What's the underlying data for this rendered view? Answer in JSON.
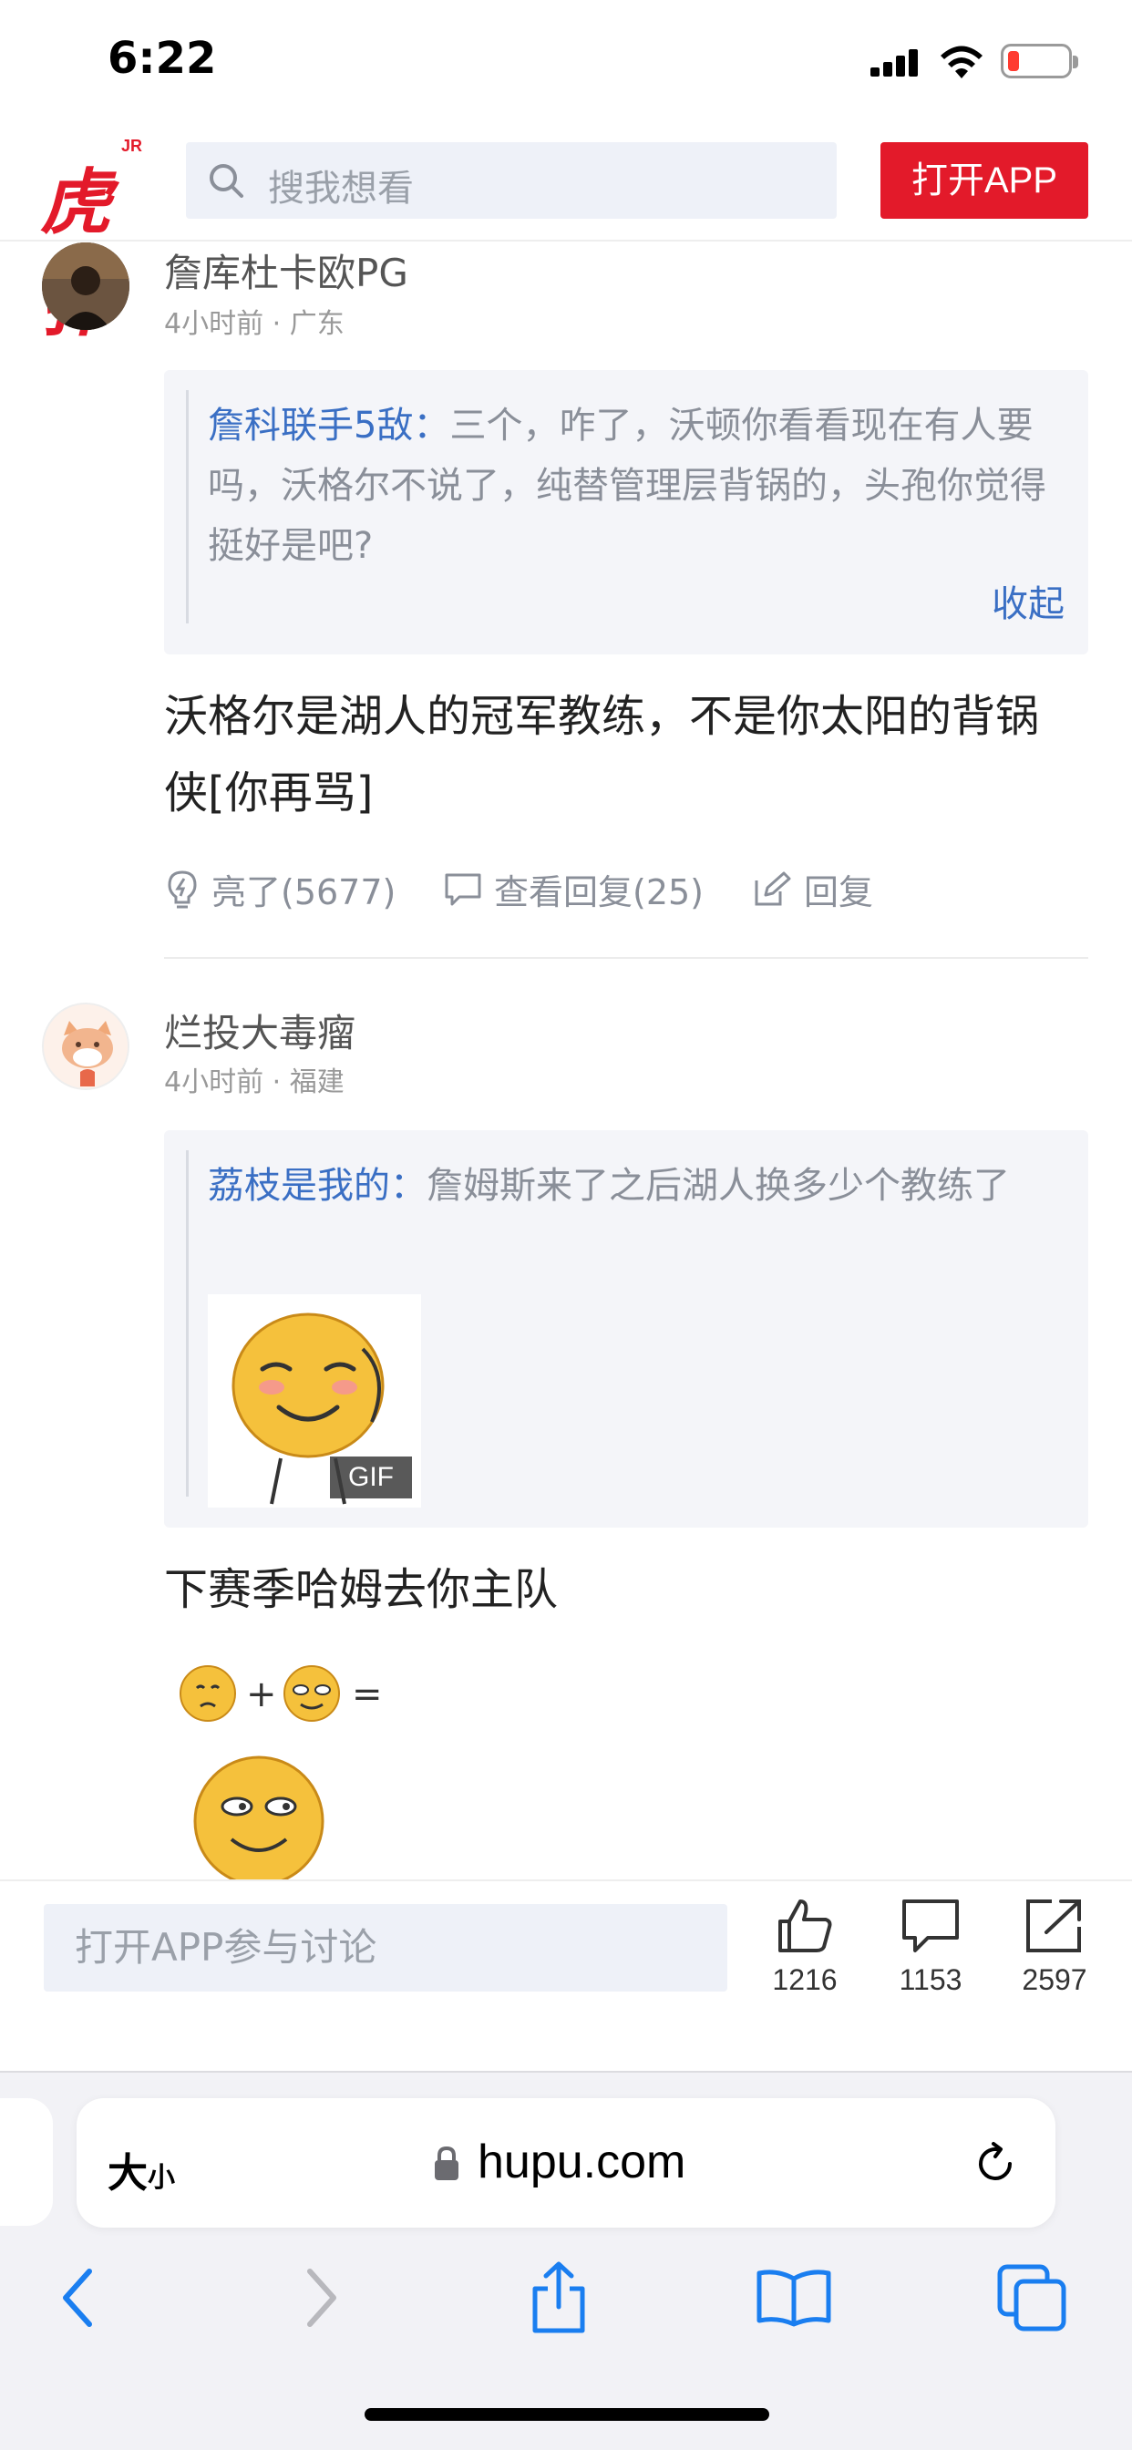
{
  "status_bar": {
    "time": "6:22"
  },
  "header": {
    "logo_text": "虎扑",
    "logo_badge": "JR",
    "search_placeholder": "搜我想看",
    "open_app_label": "打开APP"
  },
  "comments": [
    {
      "username": "詹库杜卡欧PG",
      "meta": "4小时前 · 广东",
      "quote": {
        "name": "詹科联手5敌：",
        "text": "三个，咋了，沃顿你看看现在有人要吗，沃格尔不说了，纯替管理层背锅的，头孢你觉得挺好是吧?",
        "collapse_label": "收起"
      },
      "body": "沃格尔是湖人的冠军教练，不是你太阳的背锅侠[你再骂]",
      "actions": {
        "like_label": "亮了(5677)",
        "replies_label": "查看回复(25)",
        "reply_label": "回复"
      }
    },
    {
      "username": "烂投大毒瘤",
      "meta": "4小时前 · 福建",
      "quote": {
        "name": "荔枝是我的：",
        "text": "詹姆斯来了之后湖人换多少个教练了",
        "gif_badge": "GIF"
      },
      "body": "下赛季哈姆去你主队"
    }
  ],
  "bottom_bar": {
    "discuss_placeholder": "打开APP参与讨论",
    "likes": "1216",
    "comments": "1153",
    "shares": "2597"
  },
  "safari": {
    "text_size_big": "大",
    "text_size_small": "小",
    "domain": "hupu.com"
  },
  "colors": {
    "brand_red": "#e31a2a",
    "link_blue": "#3a6fc4",
    "safari_blue": "#1a7ef0"
  }
}
